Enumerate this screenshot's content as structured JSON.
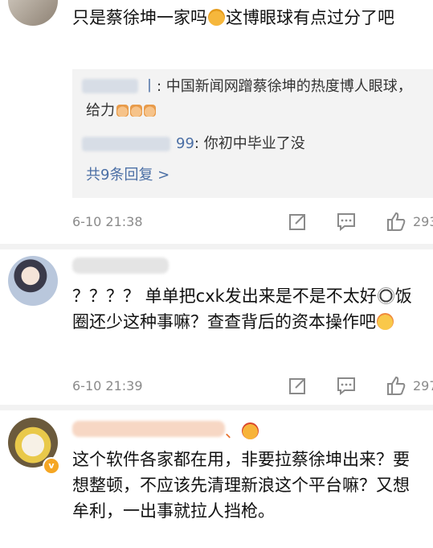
{
  "comments": [
    {
      "text_before_emoji": "只是蔡徐坤一家吗",
      "emoji": "crying-emoji",
      "text_after_emoji": "这博眼球有点过分了吧",
      "replies": [
        {
          "user_suffix": "丨",
          "text": ": 中国新闻网蹭蔡徐坤的热度博人眼球，给力"
        },
        {
          "user_suffix": "99",
          "text": ": 你初中毕业了没"
        }
      ],
      "more_replies": "共9条回复 >",
      "time": "6-10 21:38",
      "likes": "293"
    },
    {
      "text_part1": "？？？？ 单单把cxk发出来是不是不太好",
      "emoji1": "panda-emoji",
      "text_part2": "饭圈还少这种事嘛？查查背后的资本操作吧",
      "emoji2": "yum-emoji",
      "time": "6-10 21:39",
      "likes": "297"
    },
    {
      "name_suffix": "、",
      "name_emoji": "heart-eyes-emoji",
      "verified_badge": "v",
      "text": "这个软件各家都在用，非要拉蔡徐坤出来？要想整顿，不应该先清理新浪这个平台嘛？又想牟利，一出事就拉人挡枪。"
    }
  ],
  "colors": {
    "link_blue": "#4b6fa5",
    "reply_bg": "#f3f3f3",
    "meta_gray": "#8a8a8a",
    "badge_orange": "#f5a623"
  },
  "icons": {
    "forward": "share-square-icon",
    "comment": "comment-dots-icon",
    "like": "thumbs-up-icon"
  }
}
